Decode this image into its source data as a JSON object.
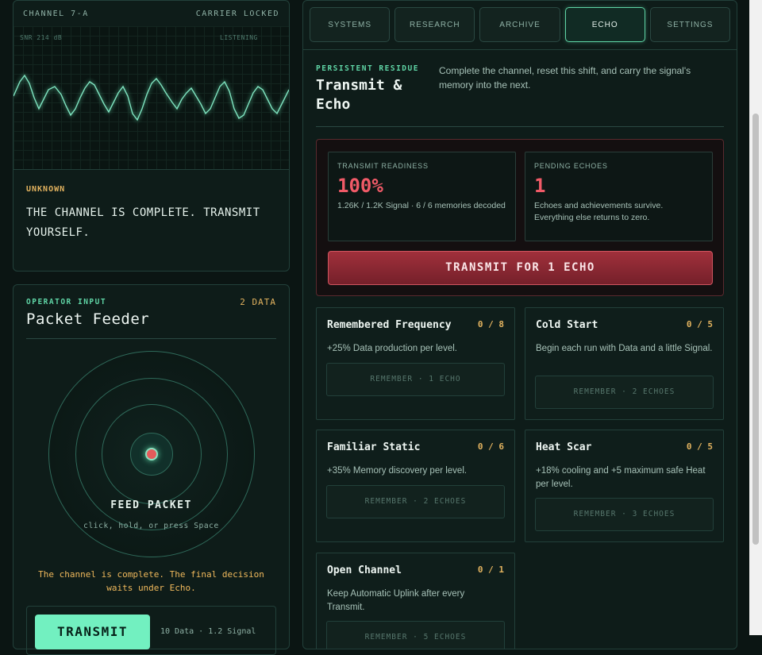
{
  "channel": {
    "name": "CHANNEL 7-A",
    "status": "CARRIER LOCKED",
    "snr": "SNR 214 dB",
    "listening": "LISTENING",
    "speaker": "UNKNOWN",
    "message": "THE CHANNEL IS COMPLETE. TRANSMIT YOURSELF."
  },
  "feeder": {
    "label": "OPERATOR INPUT",
    "data_count": "2 DATA",
    "title": "Packet Feeder",
    "feed_label": "FEED PACKET",
    "feed_hint": "click, hold, or press Space",
    "final_message": "The channel is complete. The final decision waits under Echo.",
    "transmit_label": "TRANSMIT",
    "transmit_info": "10 Data · 1.2 Signal"
  },
  "tabs": [
    {
      "label": "SYSTEMS",
      "active": false
    },
    {
      "label": "RESEARCH",
      "active": false
    },
    {
      "label": "ARCHIVE",
      "active": false
    },
    {
      "label": "ECHO",
      "active": true
    },
    {
      "label": "SETTINGS",
      "active": false
    }
  ],
  "echo": {
    "kicker": "PERSISTENT RESIDUE",
    "title": "Transmit & Echo",
    "description": "Complete the channel, reset this shift, and carry the signal's memory into the next.",
    "readiness": {
      "label": "TRANSMIT READINESS",
      "value": "100%",
      "detail": "1.26K / 1.2K Signal · 6 / 6 memories decoded"
    },
    "pending": {
      "label": "PENDING ECHOES",
      "value": "1",
      "detail": "Echoes and achievements survive. Everything else returns to zero."
    },
    "transmit_button": "TRANSMIT FOR 1 ECHO",
    "upgrades": [
      {
        "title": "Remembered Frequency",
        "count": "0 / 8",
        "desc": "+25% Data production per level.",
        "button": "REMEMBER · 1 ECHO"
      },
      {
        "title": "Cold Start",
        "count": "0 / 5",
        "desc": "Begin each run with Data and a little Signal.",
        "button": "REMEMBER · 2 ECHOES"
      },
      {
        "title": "Familiar Static",
        "count": "0 / 6",
        "desc": "+35% Memory discovery per level.",
        "button": "REMEMBER · 2 ECHOES"
      },
      {
        "title": "Heat Scar",
        "count": "0 / 5",
        "desc": "+18% cooling and +5 maximum safe Heat per level.",
        "button": "REMEMBER · 3 ECHOES"
      },
      {
        "title": "Open Channel",
        "count": "0 / 1",
        "desc": "Keep Automatic Uplink after every Transmit.",
        "button": "REMEMBER · 5 ECHOES"
      }
    ]
  },
  "colors": {
    "accent": "#5fd4a5",
    "warning": "#e3b35f",
    "danger": "#f05a67",
    "background": "#0b1513"
  }
}
